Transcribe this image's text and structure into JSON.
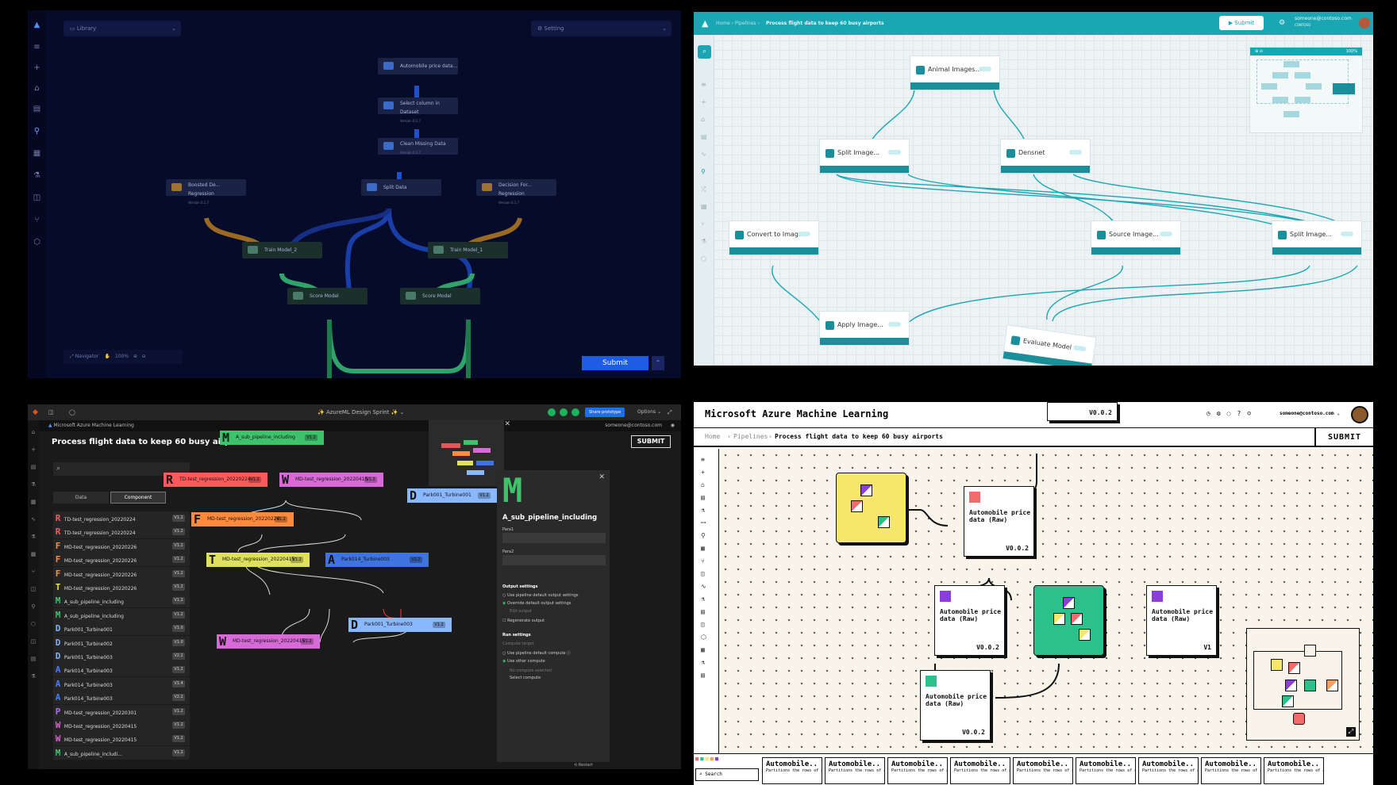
{
  "q1": {
    "library": "Library",
    "setting": "Setting",
    "nodes": [
      "Automobile price data...",
      "Select column in Dataset",
      "Clean Missing Data",
      "Boosted De... Regression",
      "Split Data",
      "Decision For... Regression",
      "Train Model_2",
      "Train Model_1",
      "Score Model",
      "Score Model"
    ],
    "version": "Version 0.1.7",
    "navigator": "Navigator",
    "zoom": "100%",
    "submit": "Submit"
  },
  "q2": {
    "crumbs": "Home  ›  Pipelines  ›",
    "title": "Process flight data to keep 60 busy airports",
    "submit": "Submit",
    "user": "someone@contoso.com",
    "org": "CONTOSO",
    "zoom": "100%",
    "nodes": [
      "Animal Images...",
      "Split Image...",
      "Densnet",
      "Convert to Imag...",
      "Source Image...",
      "Split Image...",
      "Apply Image...",
      "Evaluate Model"
    ]
  },
  "q3": {
    "window_title": "AzureML Design Sprint",
    "share": "Share prototype",
    "options": "Options",
    "app": "Microsoft Azure Machine Learning",
    "user": "someone@contoso.com",
    "title": "Process flight data to keep 60 busy airports",
    "submit": "SUBMIT",
    "tabs": [
      "Data",
      "Component"
    ],
    "list": [
      [
        "R",
        "TD-test_regression_20220224",
        "V1.2",
        "#ff5a5a"
      ],
      [
        "R",
        "TD-test_regression_20220224",
        "V1.2",
        "#ff5a5a"
      ],
      [
        "F",
        "MD-test_regression_20220226",
        "V1.2",
        "#ff8a3d"
      ],
      [
        "F",
        "MD-test_regression_20220226",
        "V1.2",
        "#ff8a3d"
      ],
      [
        "F",
        "MD-test_regression_20220226",
        "V1.2",
        "#ff8a3d"
      ],
      [
        "T",
        "MD-test_regression_20220226",
        "V1.2",
        "#e7e34f"
      ],
      [
        "M",
        "A_sub_pipeline_including",
        "V1.2",
        "#3ec26b"
      ],
      [
        "M",
        "A_sub_pipeline_including",
        "V1.2",
        "#3ec26b"
      ],
      [
        "D",
        "Park001_Turbine001",
        "V1.0",
        "#7fb2ff"
      ],
      [
        "D",
        "Park001_Turbine002",
        "V1.0",
        "#7fb2ff"
      ],
      [
        "D",
        "Park001_Turbine003",
        "V2.2",
        "#7fb2ff"
      ],
      [
        "A",
        "Park014_Turbine003",
        "V1.2",
        "#4a7dff"
      ],
      [
        "A",
        "Park014_Turbine003",
        "V1.4",
        "#4a7dff"
      ],
      [
        "A",
        "Park014_Turbine003",
        "V2.2",
        "#4a7dff"
      ],
      [
        "P",
        "MD-test_regression_20220301",
        "V1.2",
        "#b16cff"
      ],
      [
        "W",
        "MD-test_regression_20220415",
        "V1.2",
        "#e05fd0"
      ],
      [
        "W",
        "MD-test_regression_20220415",
        "V1.2",
        "#e05fd0"
      ],
      [
        "M",
        "A_sub_pipeline_includi...",
        "V1.2",
        "#3ec26b"
      ]
    ],
    "nodes": [
      [
        "M",
        "A_sub_pipeline_including",
        "V1.2",
        "#3ec26b"
      ],
      [
        "R",
        "TD-test_regression_20220224",
        "V1.2",
        "#ff5a5a"
      ],
      [
        "W",
        "MD-test_regression_20220415",
        "V1.2",
        "#d86ad8"
      ],
      [
        "F",
        "MD-test_regression_20220226",
        "V1.2",
        "#ff8a3d"
      ],
      [
        "T",
        "MD-test_regression_20220415",
        "V1.2",
        "#e0e060"
      ],
      [
        "A",
        "Park014_Turbine003",
        "V1.2",
        "#3e73e0"
      ],
      [
        "D",
        "Park001_Turbine003",
        "V1.2",
        "#8ab8ff"
      ],
      [
        "W",
        "MD-test_regression_20220415",
        "V1.2",
        "#d86ad8"
      ],
      [
        "D",
        "Park001_Turbine001",
        "V1.2",
        "#8ab8ff"
      ]
    ],
    "panel": {
      "letter": "M",
      "name": "A_sub_pipeline_including",
      "para1": "Para1",
      "para2": "Para2",
      "output_settings": "Output settings",
      "opt1": "Use pipeline default output settings",
      "opt2": "Override default output settings",
      "edit": "Edit output",
      "regen": "Regenerate output",
      "run_settings": "Run settings",
      "compute_target": "Compute target",
      "opt3": "Use pipeline default compute",
      "opt4": "Use other compute",
      "nocomp": "No compute selected",
      "selcomp": "Select compute"
    },
    "restart": "Restart"
  },
  "q4": {
    "app": "Microsoft Azure Machine Learning",
    "user": "someone@contoso.com",
    "crumbs": [
      "Home",
      "Pipelines",
      "Process flight data to keep 60 busy airports"
    ],
    "submit": "SUBMIT",
    "node_title": "Automobile price data (Raw)",
    "versions": [
      "V0.0.2",
      "V0.0.2",
      "V0.0.2",
      "V1",
      "V0.0.2"
    ],
    "search": "Search",
    "card_title": "Automobile.. V1",
    "card_desc": "Partitions the rows of a dataset into"
  }
}
